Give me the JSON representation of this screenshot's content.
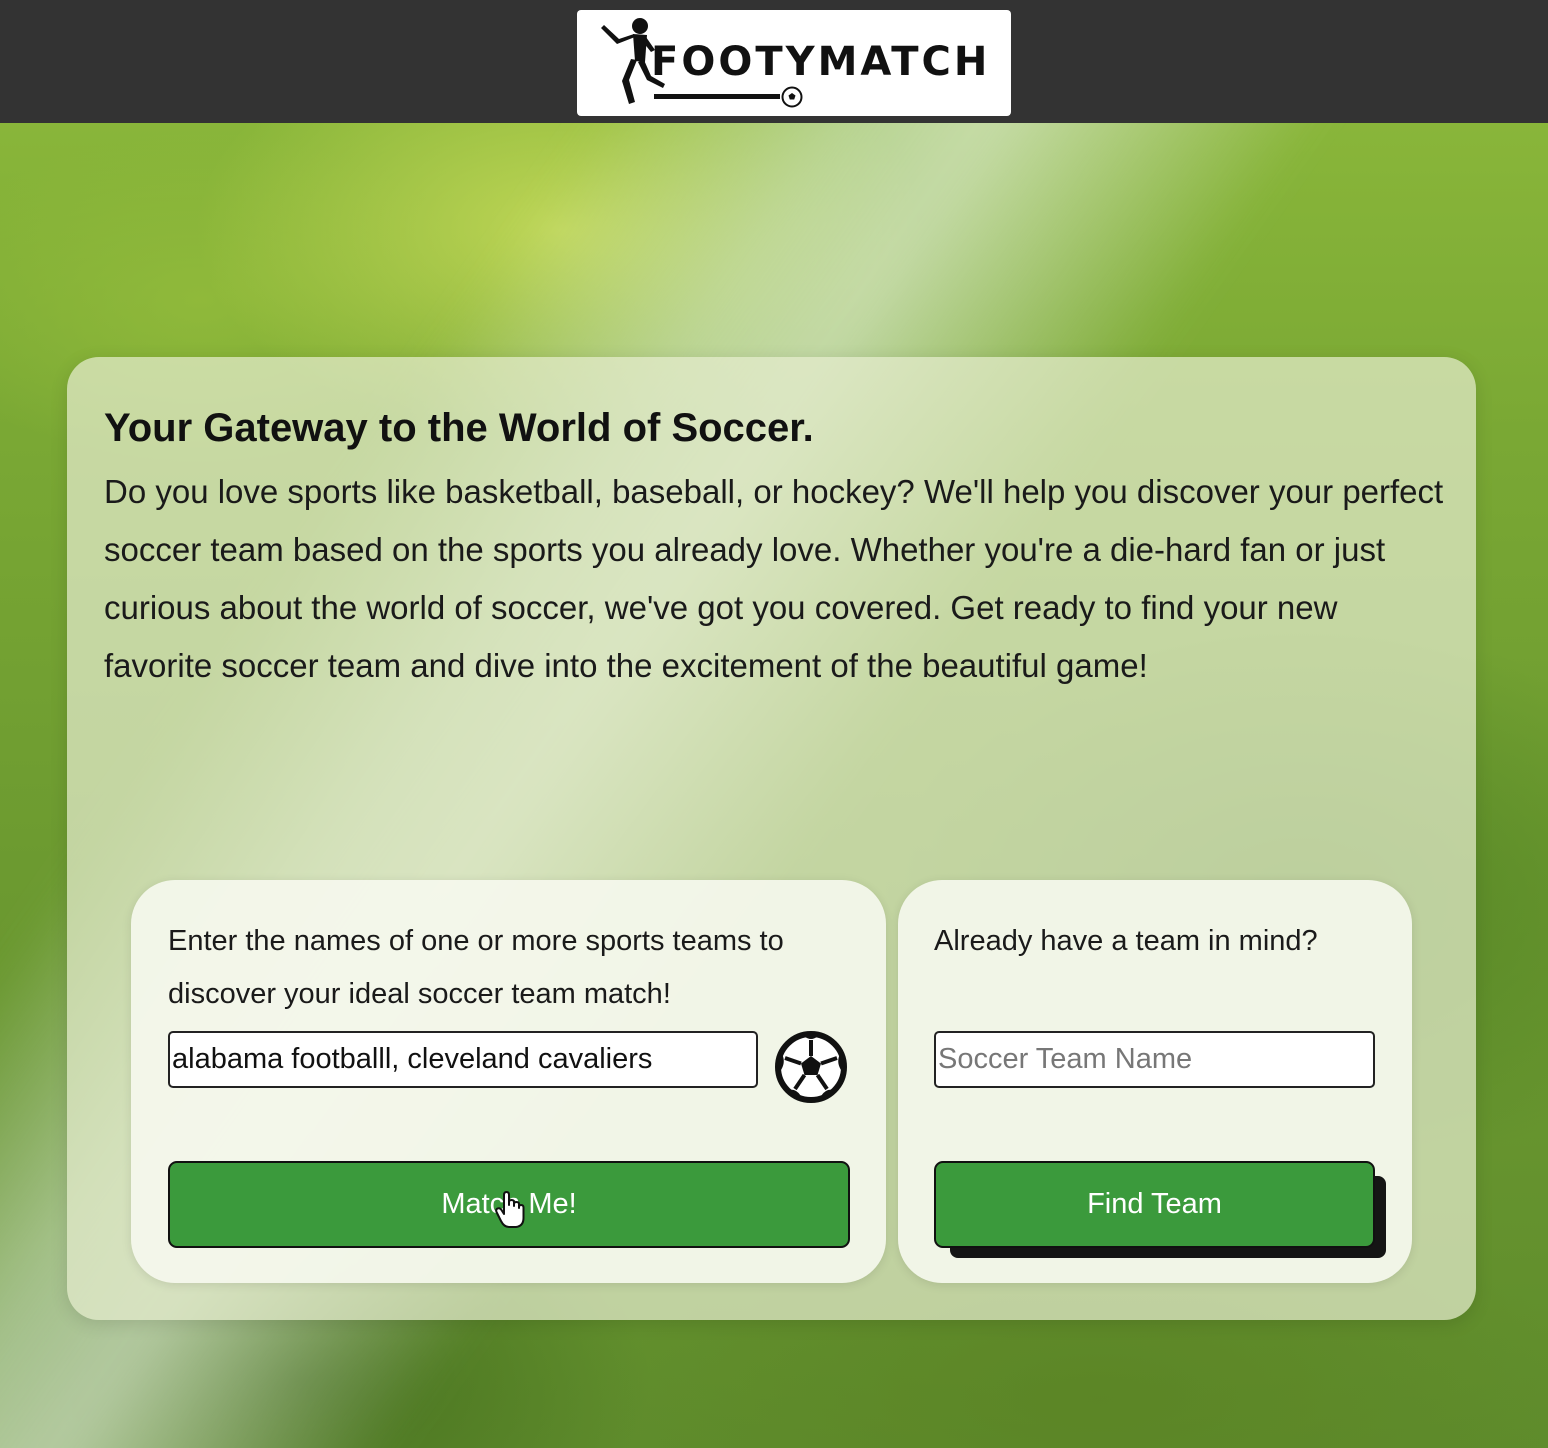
{
  "header": {
    "logo_text": "FOOTYMATCH"
  },
  "hero": {
    "title": "Your Gateway to the World of Soccer.",
    "description": "Do you love sports like basketball, baseball, or hockey? We'll help you discover your perfect soccer team based on the sports you already love. Whether you're a die-hard fan or just curious about the world of soccer, we've got you covered. Get ready to find your new favorite soccer team and dive into the excitement of the beautiful game!"
  },
  "match_panel": {
    "prompt": "Enter the names of one or more sports teams to discover your ideal soccer team match!",
    "input_value": "alabama footballl, cleveland cavaliers",
    "icon": "soccer-ball-icon",
    "button_label": "Match Me!"
  },
  "find_panel": {
    "prompt": "Already have a team in mind?",
    "input_placeholder": "Soccer Team Name",
    "button_label": "Find Team"
  },
  "colors": {
    "header": "#333333",
    "button": "#3b9a3c"
  }
}
